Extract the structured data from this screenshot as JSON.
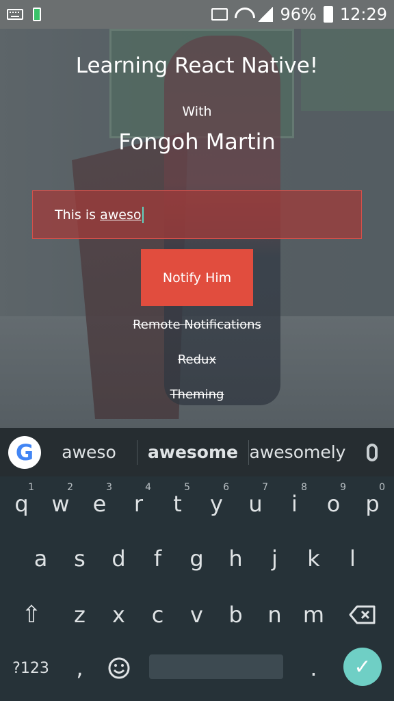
{
  "status_bar": {
    "battery": "96%",
    "time": "12:29"
  },
  "app": {
    "title": "Learning React Native!",
    "with_label": "With",
    "author": "Fongoh Martin",
    "input": {
      "prefix": "This is ",
      "typed": "aweso"
    },
    "notify_button": "Notify Him",
    "links": [
      "Remote Notifications",
      "Redux",
      "Theming"
    ]
  },
  "keyboard": {
    "suggestions": [
      "aweso",
      "awesome",
      "awesomely"
    ],
    "row1": [
      "q",
      "w",
      "e",
      "r",
      "t",
      "y",
      "u",
      "i",
      "o",
      "p"
    ],
    "row1_numbers": [
      "1",
      "2",
      "3",
      "4",
      "5",
      "6",
      "7",
      "8",
      "9",
      "0"
    ],
    "row2": [
      "a",
      "s",
      "d",
      "f",
      "g",
      "h",
      "j",
      "k",
      "l"
    ],
    "row3": [
      "z",
      "x",
      "c",
      "v",
      "b",
      "n",
      "m"
    ],
    "symbols_key": "?123",
    "comma_key": ",",
    "period_key": "."
  },
  "colors": {
    "accent_red": "#e14d3e",
    "input_bg": "#a43a39",
    "keyboard_bg": "#263238",
    "enter_teal": "#6fcfc5"
  }
}
